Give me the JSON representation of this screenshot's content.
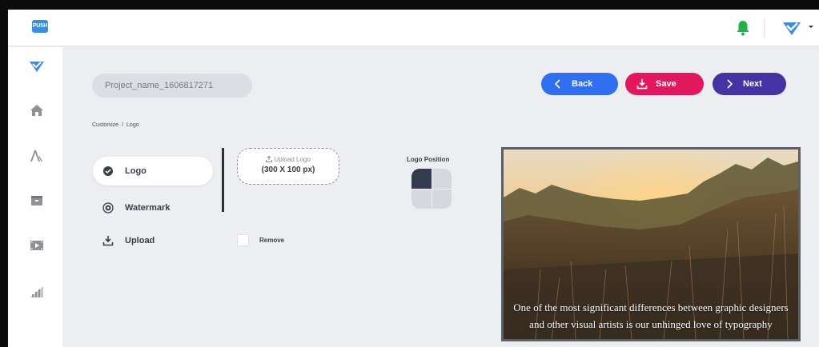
{
  "app": {
    "logo_text": "PUSH",
    "icons": {
      "notifications": "bell-icon",
      "brand": "brand-check-icon",
      "caret": "caret-down-icon"
    }
  },
  "sidebar": {
    "items": [
      {
        "name": "brand",
        "icon": "brand-check-icon"
      },
      {
        "name": "home",
        "icon": "home-icon"
      },
      {
        "name": "text",
        "icon": "text-icon"
      },
      {
        "name": "archive",
        "icon": "archive-icon"
      },
      {
        "name": "video",
        "icon": "video-icon"
      },
      {
        "name": "analytics",
        "icon": "signal-icon"
      }
    ]
  },
  "project": {
    "name": "Project_name_1606817271"
  },
  "actions": {
    "back": "Back",
    "save": "Save",
    "next": "Next"
  },
  "breadcrumb": {
    "parent": "Customize",
    "separator": "/",
    "current": "Logo"
  },
  "tabs": [
    {
      "label": "Logo",
      "active": true
    },
    {
      "label": "Watermark",
      "active": false
    },
    {
      "label": "Upload",
      "active": false
    }
  ],
  "upload": {
    "label": "Upload Logo",
    "size": "(300 X 100 px)"
  },
  "remove": {
    "label": "Remove",
    "checked": false
  },
  "logo_position": {
    "title": "Logo Position",
    "selected": "top-left"
  },
  "preview": {
    "caption": "One of the most significant differences between graphic designers and other visual artists is our unhinged love of typography"
  },
  "colors": {
    "back": "#2f6ff0",
    "save": "#e2185c",
    "next": "#4633a3",
    "bell": "#22b14c",
    "brand": "#3b8be0"
  }
}
